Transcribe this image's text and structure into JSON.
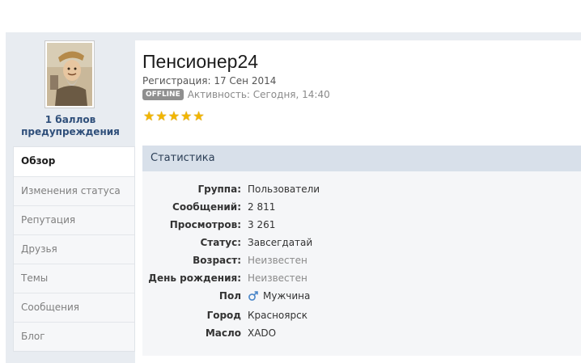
{
  "profile": {
    "username": "Пенсионер24",
    "registration": "Регистрация: 17 Сен 2014",
    "status_badge": "OFFLINE",
    "activity": "Активность: Сегодня, 14:40",
    "rating_stars": 5,
    "warnings": "1 баллов предупреждения"
  },
  "sidebar": {
    "items": [
      {
        "label": "Обзор",
        "active": true
      },
      {
        "label": "Изменения статуса",
        "active": false
      },
      {
        "label": "Репутация",
        "active": false
      },
      {
        "label": "Друзья",
        "active": false
      },
      {
        "label": "Темы",
        "active": false
      },
      {
        "label": "Сообщения",
        "active": false
      },
      {
        "label": "Блог",
        "active": false
      }
    ]
  },
  "stats": {
    "title": "Статистика",
    "rows": [
      {
        "label": "Группа:",
        "value": "Пользователи"
      },
      {
        "label": "Сообщений:",
        "value": "2 811"
      },
      {
        "label": "Просмотров:",
        "value": "3 261"
      },
      {
        "label": "Статус:",
        "value": "Завсегдатай"
      },
      {
        "label": "Возраст:",
        "value": "Неизвестен"
      },
      {
        "label": "День рождения:",
        "value": "Неизвестен"
      },
      {
        "label": "Пол",
        "value": "Мужчина"
      },
      {
        "label": "Город",
        "value": "Красноярск"
      },
      {
        "label": "Масло",
        "value": "XADO"
      }
    ]
  },
  "colors": {
    "accent_blue": "#2f4f7a",
    "header_bg": "#d8e0ea",
    "star": "#f2b600",
    "badge": "#8f8f8f"
  },
  "icons": {
    "gender": "male-gender-icon",
    "rating": "star-icon",
    "avatar": "user-avatar"
  }
}
